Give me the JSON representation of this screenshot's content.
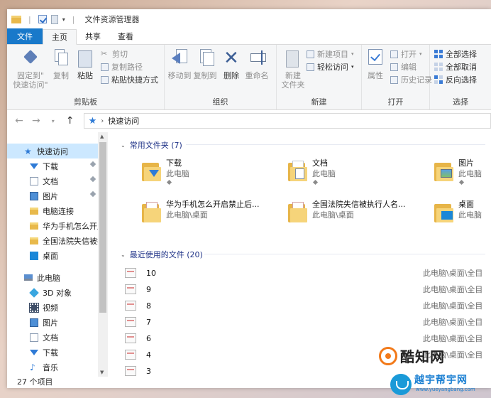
{
  "window": {
    "title": "文件资源管理器",
    "tabs": [
      {
        "label": "文件"
      },
      {
        "label": "主页"
      },
      {
        "label": "共享"
      },
      {
        "label": "查看"
      }
    ]
  },
  "ribbon": {
    "clipboard": {
      "label": "剪贴板",
      "pin_line1": "固定到\"",
      "pin_line2": "快速访问\"",
      "copy": "复制",
      "paste": "粘贴",
      "cut": "剪切",
      "copy_path": "复制路径",
      "paste_shortcut": "粘贴快捷方式"
    },
    "organize": {
      "label": "组织",
      "move_to": "移动到",
      "copy_to": "复制到",
      "delete": "删除",
      "rename": "重命名"
    },
    "new": {
      "label": "新建",
      "new_folder_line1": "新建",
      "new_folder_line2": "文件夹",
      "new_item": "新建项目",
      "easy_access": "轻松访问"
    },
    "open": {
      "label": "打开",
      "properties": "属性",
      "open": "打开",
      "edit": "编辑",
      "history": "历史记录"
    },
    "select": {
      "label": "选择",
      "select_all": "全部选择",
      "select_none": "全部取消",
      "invert": "反向选择"
    }
  },
  "address": {
    "crumb": "快速访问"
  },
  "navpane": {
    "items": [
      {
        "label": "快速访问",
        "icon": "star-icon"
      },
      {
        "label": "下载",
        "icon": "download-icon"
      },
      {
        "label": "文档",
        "icon": "document-icon"
      },
      {
        "label": "图片",
        "icon": "picture-icon"
      },
      {
        "label": "电脑连接",
        "icon": "folder-icon"
      },
      {
        "label": "华为手机怎么开启",
        "icon": "folder-icon"
      },
      {
        "label": "全国法院失信被执",
        "icon": "folder-icon"
      },
      {
        "label": "桌面",
        "icon": "desktop-icon"
      },
      {
        "label": "此电脑",
        "icon": "computer-icon"
      },
      {
        "label": "3D 对象",
        "icon": "3d-objects-icon"
      },
      {
        "label": "视频",
        "icon": "video-icon"
      },
      {
        "label": "图片",
        "icon": "picture-icon"
      },
      {
        "label": "文档",
        "icon": "document-icon"
      },
      {
        "label": "下载",
        "icon": "download-icon"
      },
      {
        "label": "音乐",
        "icon": "music-icon"
      }
    ]
  },
  "frequent": {
    "title": "常用文件夹 (7)",
    "folders": [
      {
        "name": "下载",
        "location": "此电脑"
      },
      {
        "name": "文档",
        "location": "此电脑"
      },
      {
        "name": "图片",
        "location": "此电脑"
      },
      {
        "name": "华为手机怎么开启禁止后...",
        "location": "此电脑\\桌面"
      },
      {
        "name": "全国法院失信被执行人名...",
        "location": "此电脑\\桌面"
      },
      {
        "name": "桌面",
        "location": "此电脑"
      }
    ]
  },
  "recent": {
    "title": "最近使用的文件 (20)",
    "files": [
      {
        "name": "10",
        "path": "此电脑\\桌面\\全目"
      },
      {
        "name": "9",
        "path": "此电脑\\桌面\\全目"
      },
      {
        "name": "8",
        "path": "此电脑\\桌面\\全目"
      },
      {
        "name": "7",
        "path": "此电脑\\桌面\\全目"
      },
      {
        "name": "6",
        "path": "此电脑\\桌面\\全目"
      },
      {
        "name": "4",
        "path": "此电脑\\桌面\\全目"
      },
      {
        "name": "3",
        "path": ""
      }
    ]
  },
  "status": {
    "count": "27 个项目"
  },
  "watermarks": {
    "brand1": "酷知网",
    "brand2": "越宇帮宇网",
    "brand2_url": "www.yueyangbang.com"
  }
}
